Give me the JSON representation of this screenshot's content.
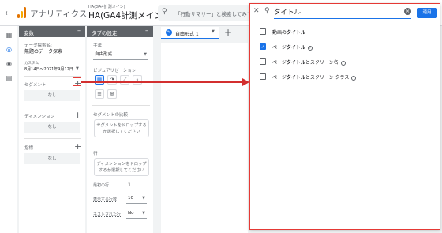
{
  "header": {
    "back_icon": "arrow-left-icon",
    "app_title": "アナリティクス",
    "property_small": "HA(GA4計測メイン)",
    "property_name": "HA(GA4計測メイン)",
    "search_placeholder": "「行動サマリー」と検索してみて"
  },
  "rail": [
    "home-icon",
    "explore-icon",
    "ads-icon",
    "reports-icon"
  ],
  "variables_panel": {
    "title": "変数",
    "exploration_name_label": "データ探索名:",
    "exploration_name": "無題のデータ探索",
    "date_label": "カスタム",
    "date_range": "8月14日～2021年9月12日",
    "segments_label": "セグメント",
    "segments_empty": "なし",
    "dimensions_label": "ディメンション",
    "dimensions_empty": "なし",
    "metrics_label": "指標",
    "metrics_empty": "なし"
  },
  "tab_panel": {
    "title": "タブの設定",
    "technique_label": "手法",
    "technique_value": "自由形式",
    "viz_label": "ビジュアリゼーション",
    "segment_compare_label": "セグメントの比較",
    "segment_drop": "セグメントをドロップするか選択してください",
    "rows_label": "行",
    "dimension_drop": "ディメンションをドロップするか選択してください",
    "first_row_label": "最初の行",
    "first_row_value": "1",
    "show_rows_label": "表示する行数",
    "show_rows_value": "10",
    "nested_rows_label": "ネストされた行",
    "nested_rows_value": "No"
  },
  "canvas": {
    "tab_label": "自由形式 1",
    "add_tab": "+"
  },
  "overlay": {
    "search_value": "タイトル",
    "apply_label": "適用",
    "options": [
      {
        "pre": "動画の",
        "bold": "タイトル",
        "post": "",
        "checked": false,
        "help": false
      },
      {
        "pre": "ページ",
        "bold": "タイトル",
        "post": "",
        "checked": true,
        "help": true
      },
      {
        "pre": "ページ",
        "bold": "タイトル",
        "post": "とスクリーン名",
        "checked": false,
        "help": true
      },
      {
        "pre": "ページ",
        "bold": "タイトル",
        "post": "とスクリーン クラス",
        "checked": false,
        "help": true
      }
    ]
  },
  "colors": {
    "accent": "#1a73e8",
    "highlight": "#e53935",
    "panel_header": "#5f6368"
  }
}
